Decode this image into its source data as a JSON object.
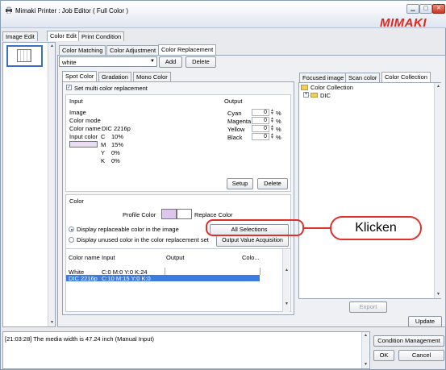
{
  "window": {
    "title": "Mimaki Printer : Job Editor ( Full Color )",
    "logo": "MIMAKI"
  },
  "main_tabs": [
    "Image Edit",
    "Color Edit",
    "Print Condition"
  ],
  "sub_tabs": [
    "Color Matching",
    "Color Adjustment",
    "Color Replacement"
  ],
  "set_select": {
    "value": "white"
  },
  "set_buttons": {
    "add": "Add",
    "delete": "Delete"
  },
  "mode_tabs": [
    "Spot Color",
    "Gradation",
    "Mono Color"
  ],
  "multi_replacement": {
    "label": "Set multi color replacement",
    "checked": true
  },
  "input_group": {
    "title": "Input",
    "image_label": "Image",
    "color_mode_label": "Color mode",
    "color_name_label": "Color name",
    "color_name_value": "DIC 2216p",
    "input_color_label": "Input color",
    "cmyk": [
      {
        "ch": "C",
        "val": "10%"
      },
      {
        "ch": "M",
        "val": "15%"
      },
      {
        "ch": "Y",
        "val": "0%"
      },
      {
        "ch": "K",
        "val": "0%"
      }
    ],
    "swatch_color": "#e9dcf3"
  },
  "output_group": {
    "title": "Output",
    "channels": [
      {
        "name": "Cyan",
        "value": "0",
        "unit": "%"
      },
      {
        "name": "Magenta",
        "value": "0",
        "unit": "%"
      },
      {
        "name": "Yellow",
        "value": "0",
        "unit": "%"
      },
      {
        "name": "Black",
        "value": "0",
        "unit": "%"
      }
    ]
  },
  "io_buttons": {
    "setup": "Setup",
    "delete": "Delete"
  },
  "color_group": {
    "title": "Color",
    "profile_color_label": "Profile Color",
    "replace_color_label": "Replace Color",
    "profile_swatch": "#dcc6ee",
    "replace_swatch": "#ffffff",
    "radio_replaceable": "Display replaceable color in the image",
    "radio_unused": "Display unused color in the color replacement set",
    "all_selections": "All Selections",
    "output_value_acquisition": "Output Value Acquisition"
  },
  "color_table": {
    "headers": [
      "Color name",
      "Input",
      "Output",
      "Colo..."
    ],
    "rows": [
      {
        "name": "White",
        "input": "C:0 M:0 Y:0 K:24",
        "output": "",
        "selected": false
      },
      {
        "name": "DIC 2216p",
        "input": "C:10 M:15 Y:0 K:0",
        "output": "",
        "selected": true
      }
    ]
  },
  "right_tabs": [
    "Focused image",
    "Scan color",
    "Color Collection"
  ],
  "tree": [
    {
      "label": "Color Collection",
      "level": 0,
      "expander": ""
    },
    {
      "label": "DIC",
      "level": 1,
      "expander": "+"
    }
  ],
  "export_label": "Export",
  "update_label": "Update",
  "log_text": "[21:03:28] The media width is 47.24 inch (Manual Input)",
  "bottom_buttons": {
    "condition": "Condition Management",
    "ok": "OK",
    "cancel": "Cancel"
  },
  "callout": {
    "text": "Klicken",
    "color": "#e0302a"
  }
}
